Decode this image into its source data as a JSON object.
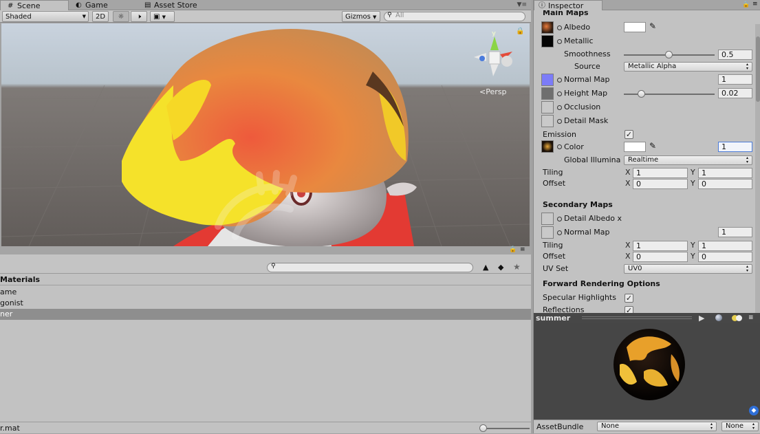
{
  "scene_window": {
    "tabs": [
      {
        "label": "Scene",
        "icon": "grid-icon",
        "active": true
      },
      {
        "label": "Game",
        "icon": "game-controller-icon",
        "active": false
      },
      {
        "label": "Asset Store",
        "icon": "store-icon",
        "active": false
      }
    ],
    "toolbar": {
      "shading_mode": "Shaded",
      "mode_2d": "2D",
      "gizmos_label": "Gizmos",
      "search_placeholder": "All"
    },
    "viewport": {
      "gizmo": {
        "y_axis": "y",
        "projection": "Persp"
      }
    }
  },
  "project_panel": {
    "header": "Materials",
    "items": [
      {
        "label": "ame",
        "selected": false
      },
      {
        "label": "gonist",
        "selected": false
      },
      {
        "label": "ner",
        "selected": true
      }
    ],
    "status_path": "r.mat"
  },
  "inspector": {
    "tab_label": "Inspector",
    "main_maps": {
      "title": "Main Maps",
      "albedo_label": "Albedo",
      "metallic_label": "Metallic",
      "smoothness_label": "Smoothness",
      "smoothness_value": "0.5",
      "smoothness_level": 0.5,
      "source_label": "Source",
      "source_value": "Metallic Alpha",
      "normal_map_label": "Normal Map",
      "normal_map_value": "1",
      "height_map_label": "Height Map",
      "height_map_value": "0.02",
      "height_level": 0.2,
      "occlusion_label": "Occlusion",
      "detail_mask_label": "Detail Mask",
      "emission_label": "Emission",
      "emission_checked": true,
      "color_label": "Color",
      "color_value": "1",
      "gi_label": "Global Illumina",
      "gi_value": "Realtime",
      "tiling_label": "Tiling",
      "tiling_x": "1",
      "tiling_y": "1",
      "offset_label": "Offset",
      "offset_x": "0",
      "offset_y": "0"
    },
    "secondary_maps": {
      "title": "Secondary Maps",
      "detail_albedo_label": "Detail Albedo x",
      "normal_map_label": "Normal Map",
      "normal_map_value": "1",
      "tiling_label": "Tiling",
      "tiling_x": "1",
      "tiling_y": "1",
      "offset_label": "Offset",
      "offset_x": "0",
      "offset_y": "0",
      "uv_set_label": "UV Set",
      "uv_set_value": "UV0"
    },
    "forward_rendering": {
      "title": "Forward Rendering Options",
      "specular_label": "Specular Highlights",
      "specular_checked": true,
      "reflections_label": "Reflections",
      "reflections_checked": true
    },
    "axis_x": "X",
    "axis_y": "Y"
  },
  "preview": {
    "material_name": "summer"
  },
  "asset_bundle": {
    "label": "AssetBundle",
    "name_value": "None",
    "variant_value": "None"
  },
  "colors": {
    "normal_map_swatch": "#7c7cf8",
    "height_map_swatch": "#6f6f6f",
    "selection": "#8e8e8e",
    "focus_border": "#4b7bd8"
  }
}
